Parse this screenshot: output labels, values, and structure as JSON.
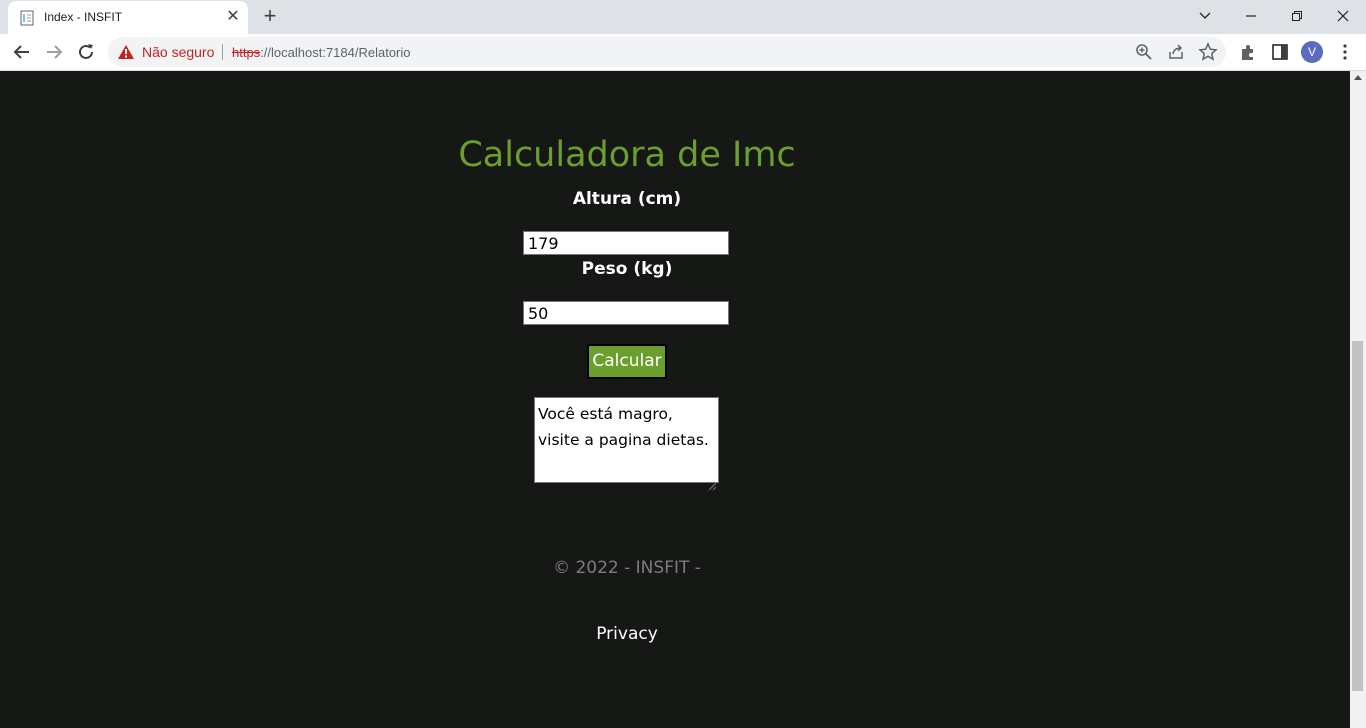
{
  "browser": {
    "tab_title": "Index - INSFIT",
    "security_label": "Não seguro",
    "url_scheme": "https",
    "url_rest": "://localhost:7184/Relatorio",
    "avatar_letter": "V"
  },
  "page": {
    "title": "Calculadora de Imc",
    "height_label": "Altura (cm)",
    "height_value": "179",
    "weight_label": "Peso (kg)",
    "weight_value": "50",
    "calc_button": "Calcular",
    "result_text": "Você está magro, visite a pagina dietas.",
    "footer_text": "© 2022 - INSFIT -",
    "privacy_link": "Privacy"
  },
  "colors": {
    "background": "#161816",
    "accent": "#6a9e2d"
  },
  "icons": [
    "page-icon",
    "close-icon",
    "plus-icon",
    "chevron-down-icon",
    "minimize-icon",
    "restore-icon",
    "window-close-icon",
    "back-icon",
    "forward-icon",
    "reload-icon",
    "warning-icon",
    "zoom-icon",
    "share-icon",
    "star-icon",
    "extensions-icon",
    "side-panel-icon",
    "menu-icon"
  ]
}
